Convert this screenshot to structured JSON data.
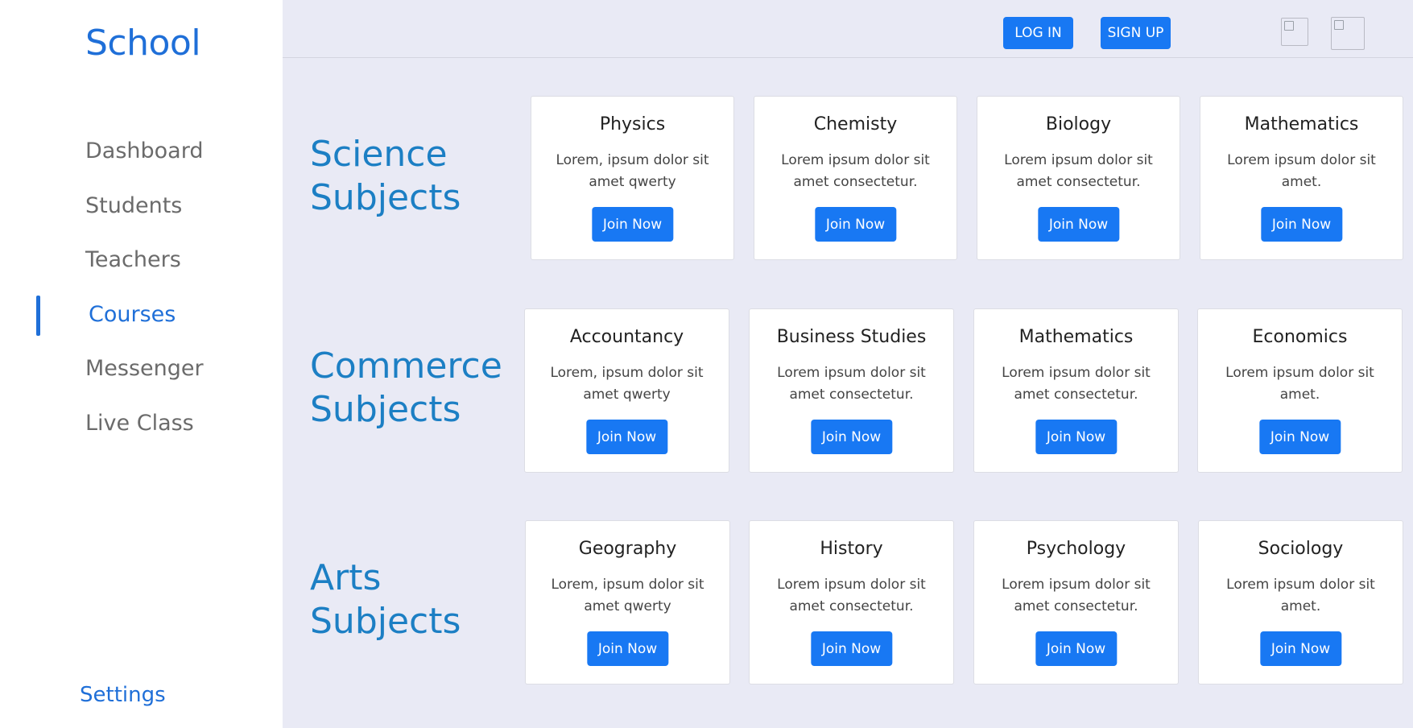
{
  "sidebar": {
    "brand": "School",
    "items": [
      {
        "label": "Dashboard",
        "active": false
      },
      {
        "label": "Students",
        "active": false
      },
      {
        "label": "Teachers",
        "active": false
      },
      {
        "label": "Courses",
        "active": true
      },
      {
        "label": "Messenger",
        "active": false
      },
      {
        "label": "Live Class",
        "active": false
      }
    ],
    "settings": "Settings"
  },
  "topbar": {
    "login": "LOG IN",
    "signup": "SIGN UP",
    "images": [
      "broken-image-icon",
      "broken-image-icon"
    ]
  },
  "sections": [
    {
      "title_line1": "Science",
      "title_line2": "Subjects",
      "cards": [
        {
          "title": "Physics",
          "desc_line1": "Lorem, ipsum dolor sit",
          "desc_line2": "amet qwerty",
          "button": "Join Now"
        },
        {
          "title": "Chemisty",
          "desc_line1": "Lorem ipsum dolor sit",
          "desc_line2": "amet consectetur.",
          "button": "Join Now"
        },
        {
          "title": "Biology",
          "desc_line1": "Lorem ipsum dolor sit",
          "desc_line2": "amet consectetur.",
          "button": "Join Now"
        },
        {
          "title": "Mathematics",
          "desc_line1": "Lorem ipsum dolor sit",
          "desc_line2": "amet.",
          "button": "Join Now"
        }
      ]
    },
    {
      "title_line1": "Commerce",
      "title_line2": "Subjects",
      "cards": [
        {
          "title": "Accountancy",
          "desc_line1": "Lorem, ipsum dolor sit",
          "desc_line2": "amet qwerty",
          "button": "Join Now"
        },
        {
          "title": "Business Studies",
          "desc_line1": "Lorem ipsum dolor sit",
          "desc_line2": "amet consectetur.",
          "button": "Join Now"
        },
        {
          "title": "Mathematics",
          "desc_line1": "Lorem ipsum dolor sit",
          "desc_line2": "amet consectetur.",
          "button": "Join Now"
        },
        {
          "title": "Economics",
          "desc_line1": "Lorem ipsum dolor sit",
          "desc_line2": "amet.",
          "button": "Join Now"
        }
      ]
    },
    {
      "title_line1": "Arts",
      "title_line2": "Subjects",
      "cards": [
        {
          "title": "Geography",
          "desc_line1": "Lorem, ipsum dolor sit",
          "desc_line2": "amet qwerty",
          "button": "Join Now"
        },
        {
          "title": "History",
          "desc_line1": "Lorem ipsum dolor sit",
          "desc_line2": "amet consectetur.",
          "button": "Join Now"
        },
        {
          "title": "Psychology",
          "desc_line1": "Lorem ipsum dolor sit",
          "desc_line2": "amet consectetur.",
          "button": "Join Now"
        },
        {
          "title": "Sociology",
          "desc_line1": "Lorem ipsum dolor sit",
          "desc_line2": "amet.",
          "button": "Join Now"
        }
      ]
    }
  ],
  "colors": {
    "brand": "#1f6fd8",
    "section_title": "#1c7fc4",
    "button": "#1878f3",
    "background": "#e9eaf5"
  }
}
